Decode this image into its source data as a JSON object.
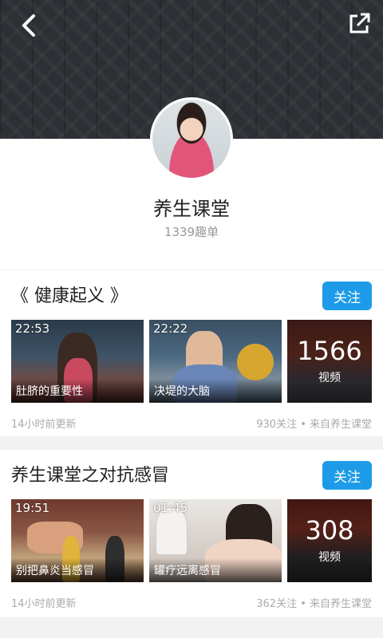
{
  "header": {
    "back_icon": "chevron-left-icon",
    "share_icon": "external-link-icon"
  },
  "profile": {
    "name": "养生课堂",
    "subtitle": "1339趣单"
  },
  "colors": {
    "accent": "#1e9be8",
    "header_bg": "#2c2f33",
    "muted_text": "#999999"
  },
  "playlists": [
    {
      "title": "《 健康起义 》",
      "follow_label": "关注",
      "videos": [
        {
          "duration": "22:53",
          "caption": "肚脐的重要性"
        },
        {
          "duration": "22:22",
          "caption": "决堤的大脑"
        }
      ],
      "more": {
        "count": "1566",
        "label": "视频"
      },
      "updated": "14小时前更新",
      "stats": "930关注 • 来自养生课堂"
    },
    {
      "title": "养生课堂之对抗感冒",
      "follow_label": "关注",
      "videos": [
        {
          "duration": "19:51",
          "caption": "别把鼻炎当感冒"
        },
        {
          "duration": "01:45",
          "caption": "罐疗远离感冒"
        }
      ],
      "more": {
        "count": "308",
        "label": "视频"
      },
      "updated": "14小时前更新",
      "stats": "362关注 • 来自养生课堂"
    }
  ]
}
